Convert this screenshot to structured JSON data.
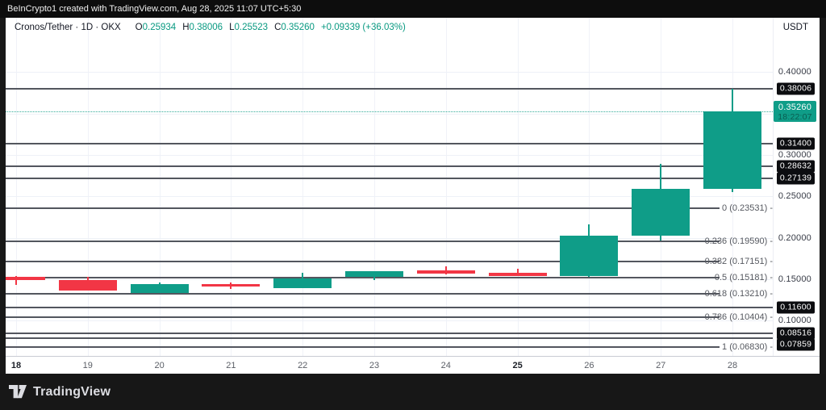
{
  "top_bar": {
    "attribution": "BeInCrypto1 created with TradingView.com, Aug 28, 2025 11:07 UTC+5:30"
  },
  "header": {
    "symbol": "Cronos/Tether · 1D · OKX",
    "ohlc": [
      {
        "key": "O",
        "val": "0.25934"
      },
      {
        "key": "H",
        "val": "0.38006"
      },
      {
        "key": "L",
        "val": "0.25523"
      },
      {
        "key": "C",
        "val": "0.35260"
      }
    ],
    "change": "+0.09339 (+36.03%)",
    "quote_currency": "USDT"
  },
  "bottom_bar": {
    "brand": "TradingView"
  },
  "colors": {
    "up": "#0f9d88",
    "down": "#f23645",
    "accent": "#089981",
    "badge_bg": "#0c0d10",
    "drawing_line": "#53565e"
  },
  "chart_data": {
    "type": "candlestick",
    "title": "Cronos/Tether · 1D · OKX",
    "quote": "USDT",
    "x_labels": [
      {
        "label": "18",
        "bold": true
      },
      {
        "label": "19",
        "bold": false
      },
      {
        "label": "20",
        "bold": false
      },
      {
        "label": "21",
        "bold": false
      },
      {
        "label": "22",
        "bold": false
      },
      {
        "label": "23",
        "bold": false
      },
      {
        "label": "24",
        "bold": false
      },
      {
        "label": "25",
        "bold": true
      },
      {
        "label": "26",
        "bold": false
      },
      {
        "label": "27",
        "bold": false
      },
      {
        "label": "28",
        "bold": false
      }
    ],
    "candles": [
      {
        "x": "18",
        "o": 0.153,
        "h": 0.1535,
        "l": 0.143,
        "c": 0.1492
      },
      {
        "x": "19",
        "o": 0.149,
        "h": 0.1527,
        "l": 0.1362,
        "c": 0.1365
      },
      {
        "x": "20",
        "o": 0.1337,
        "h": 0.1465,
        "l": 0.1334,
        "c": 0.1444
      },
      {
        "x": "21",
        "o": 0.1438,
        "h": 0.1458,
        "l": 0.1386,
        "c": 0.1413
      },
      {
        "x": "22",
        "o": 0.1396,
        "h": 0.1582,
        "l": 0.1394,
        "c": 0.151
      },
      {
        "x": "23",
        "o": 0.1526,
        "h": 0.16,
        "l": 0.149,
        "c": 0.1597
      },
      {
        "x": "24",
        "o": 0.1607,
        "h": 0.1658,
        "l": 0.1558,
        "c": 0.1568
      },
      {
        "x": "25",
        "o": 0.1576,
        "h": 0.1631,
        "l": 0.154,
        "c": 0.1543
      },
      {
        "x": "26",
        "o": 0.1543,
        "h": 0.2159,
        "l": 0.1529,
        "c": 0.2023
      },
      {
        "x": "27",
        "o": 0.2023,
        "h": 0.2889,
        "l": 0.1964,
        "c": 0.2593
      },
      {
        "x": "28",
        "o": 0.25934,
        "h": 0.38006,
        "l": 0.25523,
        "c": 0.3526
      }
    ],
    "y_ticks": [
      {
        "label": "0.40000",
        "value": 0.4
      },
      {
        "label": "0.30000",
        "value": 0.3
      },
      {
        "label": "0.25000",
        "value": 0.25
      },
      {
        "label": "0.20000",
        "value": 0.2
      },
      {
        "label": "0.15000",
        "value": 0.15
      },
      {
        "label": "0.10000",
        "value": 0.1
      }
    ],
    "grid_extra_values": [
      0.35
    ],
    "price_lines": [
      {
        "label": "0.38006",
        "value": 0.38006
      },
      {
        "label": "0.31400",
        "value": 0.314
      },
      {
        "label": "0.28632",
        "value": 0.28632
      },
      {
        "label": "0.27139",
        "value": 0.27139
      },
      {
        "label": "0.11600",
        "value": 0.116
      },
      {
        "label": "0.08516",
        "value": 0.08516
      },
      {
        "label": "0.07859",
        "value": 0.07859
      }
    ],
    "fib_levels": [
      {
        "label": "0 (0.23531) -",
        "value": 0.23531
      },
      {
        "label": "0.236 (0.19590) -",
        "value": 0.1959
      },
      {
        "label": "0.382 (0.17151) -",
        "value": 0.17151
      },
      {
        "label": "0.5 (0.15181) -",
        "value": 0.15181
      },
      {
        "label": "0.618 (0.13210) -",
        "value": 0.1321
      },
      {
        "label": "0.786 (0.10404) -",
        "value": 0.10404
      },
      {
        "label": "1 (0.06830) -",
        "value": 0.0683
      }
    ],
    "last_price": {
      "label": "0.35260",
      "value": 0.3526,
      "countdown": "18:22:07"
    },
    "y_range_visible": [
      0.0555,
      0.4431
    ],
    "grid": true,
    "legend_position": "top-left"
  }
}
